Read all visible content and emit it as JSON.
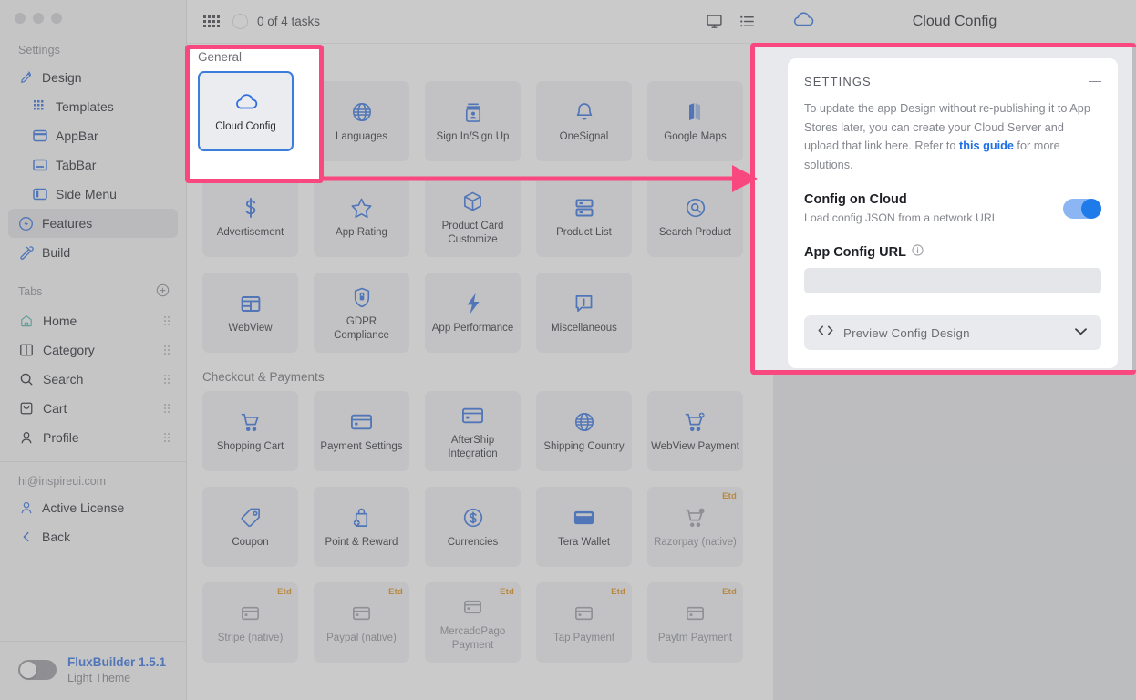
{
  "window": {
    "traffic_lights": 3
  },
  "sidebar": {
    "settings_label": "Settings",
    "items": [
      {
        "label": "Design",
        "icon": "design-pen-icon",
        "sub": false,
        "active": false
      },
      {
        "label": "Templates",
        "icon": "templates-grid-icon",
        "sub": true,
        "active": false
      },
      {
        "label": "AppBar",
        "icon": "appbar-icon",
        "sub": true,
        "active": false
      },
      {
        "label": "TabBar",
        "icon": "tabbar-icon",
        "sub": true,
        "active": false
      },
      {
        "label": "Side Menu",
        "icon": "side-menu-icon",
        "sub": true,
        "active": false
      },
      {
        "label": "Features",
        "icon": "features-bolt-icon",
        "sub": false,
        "active": true
      },
      {
        "label": "Build",
        "icon": "build-hammer-icon",
        "sub": false,
        "active": false
      }
    ],
    "tabs_label": "Tabs",
    "tabs_add_icon": "plus-circle-icon",
    "tabs": [
      {
        "label": "Home",
        "icon": "home-icon"
      },
      {
        "label": "Category",
        "icon": "category-icon"
      },
      {
        "label": "Search",
        "icon": "search-icon"
      },
      {
        "label": "Cart",
        "icon": "cart-icon"
      },
      {
        "label": "Profile",
        "icon": "profile-icon"
      }
    ],
    "account_email": "hi@inspireui.com",
    "account_items": [
      {
        "label": "Active License",
        "icon": "user-license-icon"
      },
      {
        "label": "Back",
        "icon": "chevron-left-icon"
      }
    ],
    "theme": {
      "toggle_state": "off",
      "app_name": "FluxBuilder 1.5.1",
      "theme_name": "Light Theme"
    }
  },
  "topbar": {
    "apps_icon": "apps-grid-icon",
    "tasks_text": "0 of 4 tasks",
    "monitor_icon": "monitor-icon",
    "list_icon": "list-icon"
  },
  "main": {
    "groups": [
      {
        "label": "General",
        "cards": [
          {
            "label": "Cloud Config",
            "icon": "cloud-icon",
            "selected": true,
            "badge": ""
          },
          {
            "label": "Languages",
            "icon": "globe-icon",
            "selected": false,
            "badge": ""
          },
          {
            "label": "Sign In/Sign Up",
            "icon": "signin-icon",
            "selected": false,
            "badge": ""
          },
          {
            "label": "OneSignal",
            "icon": "bell-icon",
            "selected": false,
            "badge": ""
          },
          {
            "label": "Google Maps",
            "icon": "map-icon",
            "selected": false,
            "badge": ""
          },
          {
            "label": "Advertisement",
            "icon": "dollar-icon",
            "selected": false,
            "badge": ""
          },
          {
            "label": "App Rating",
            "icon": "star-icon",
            "selected": false,
            "badge": ""
          },
          {
            "label": "Product Card Customize",
            "icon": "box-icon",
            "selected": false,
            "badge": ""
          },
          {
            "label": "Product List",
            "icon": "list-rows-icon",
            "selected": false,
            "badge": ""
          },
          {
            "label": "Search Product",
            "icon": "search-circle-icon",
            "selected": false,
            "badge": ""
          },
          {
            "label": "WebView",
            "icon": "webview-icon",
            "selected": false,
            "badge": ""
          },
          {
            "label": "GDPR Compliance",
            "icon": "shield-lock-icon",
            "selected": false,
            "badge": ""
          },
          {
            "label": "App Performance",
            "icon": "bolt-icon",
            "selected": false,
            "badge": ""
          },
          {
            "label": "Miscellaneous",
            "icon": "chat-alert-icon",
            "selected": false,
            "badge": ""
          }
        ]
      },
      {
        "label": "Checkout & Payments",
        "cards": [
          {
            "label": "Shopping Cart",
            "icon": "shopping-cart-icon",
            "selected": false,
            "badge": ""
          },
          {
            "label": "Payment Settings",
            "icon": "credit-card-icon",
            "selected": false,
            "badge": ""
          },
          {
            "label": "AfterShip Integration",
            "icon": "credit-card-icon",
            "selected": false,
            "badge": ""
          },
          {
            "label": "Shipping Country",
            "icon": "globe-icon",
            "selected": false,
            "badge": ""
          },
          {
            "label": "WebView Payment",
            "icon": "cart-plus-icon",
            "selected": false,
            "badge": ""
          },
          {
            "label": "Coupon",
            "icon": "tag-icon",
            "selected": false,
            "badge": ""
          },
          {
            "label": "Point & Reward",
            "icon": "bag-plus-icon",
            "selected": false,
            "badge": ""
          },
          {
            "label": "Currencies",
            "icon": "dollar-circle-icon",
            "selected": false,
            "badge": ""
          },
          {
            "label": "Tera Wallet",
            "icon": "wallet-icon",
            "selected": false,
            "badge": ""
          },
          {
            "label": "Razorpay (native)",
            "icon": "cart-plus-icon",
            "selected": false,
            "badge": "Etd",
            "disabled": true
          },
          {
            "label": "Stripe (native)",
            "icon": "credit-card-icon",
            "selected": false,
            "badge": "Etd",
            "disabled": true
          },
          {
            "label": "Paypal (native)",
            "icon": "credit-card-icon",
            "selected": false,
            "badge": "Etd",
            "disabled": true
          },
          {
            "label": "MercadoPago Payment",
            "icon": "credit-card-icon",
            "selected": false,
            "badge": "Etd",
            "disabled": true
          },
          {
            "label": "Tap Payment",
            "icon": "credit-card-icon",
            "selected": false,
            "badge": "Etd",
            "disabled": true
          },
          {
            "label": "Paytm Payment",
            "icon": "credit-card-icon",
            "selected": false,
            "badge": "Etd",
            "disabled": true
          }
        ]
      }
    ]
  },
  "right_panel": {
    "header_icon": "cloud-icon",
    "header_title": "Cloud Config",
    "settings_title": "SETTINGS",
    "collapse_icon": "minus-icon",
    "description_part1": "To update the app Design without re-publishing it to App Stores later, you can create your Cloud Server and upload that link here. Refer to ",
    "description_link": "this guide",
    "description_part2": " for more solutions.",
    "config_on_cloud": {
      "title": "Config on Cloud",
      "subtitle": "Load config JSON from a network URL",
      "toggle_state": "on"
    },
    "app_config_url": {
      "label": "App Config URL",
      "info_icon": "info-icon",
      "value": "",
      "placeholder": ""
    },
    "preview": {
      "code_icon": "code-brackets-icon",
      "label": "Preview Config Design",
      "chevron_icon": "chevron-down-icon"
    }
  },
  "annotations": {
    "highlight_color": "#f9477f",
    "arrow": "right-arrow"
  },
  "colors": {
    "accent_blue": "#2f6fe0",
    "highlight_pink": "#f9477f",
    "toggle_on": "#1f7aea",
    "badge_orange": "#e08e12"
  }
}
